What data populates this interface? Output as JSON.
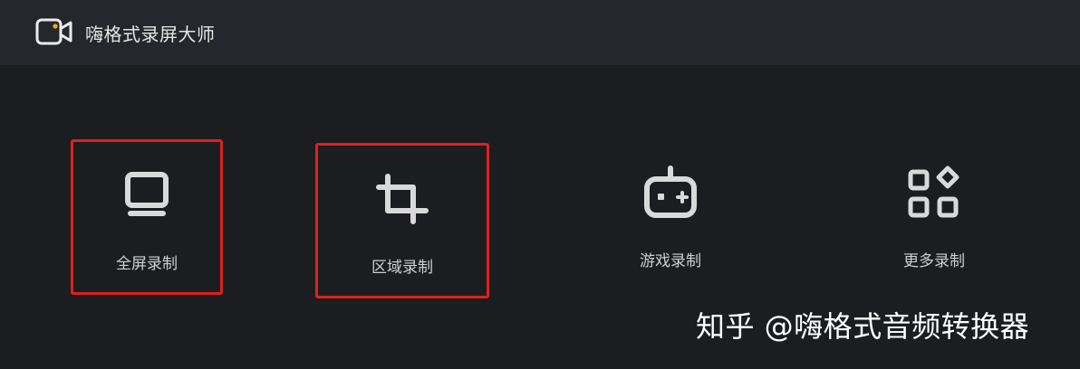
{
  "app": {
    "title": "嗨格式录屏大师",
    "logo_icon": "video-camera-icon",
    "accent_color": "#f5a623"
  },
  "modes": [
    {
      "label": "全屏录制",
      "icon": "monitor-icon",
      "highlighted": true
    },
    {
      "label": "区域录制",
      "icon": "crop-icon",
      "highlighted": true
    },
    {
      "label": "游戏录制",
      "icon": "gamepad-icon",
      "highlighted": false
    },
    {
      "label": "更多录制",
      "icon": "apps-icon",
      "highlighted": false
    }
  ],
  "highlight_color": "#e0201c",
  "watermark": {
    "text": "知乎 @嗨格式音频转换器"
  }
}
